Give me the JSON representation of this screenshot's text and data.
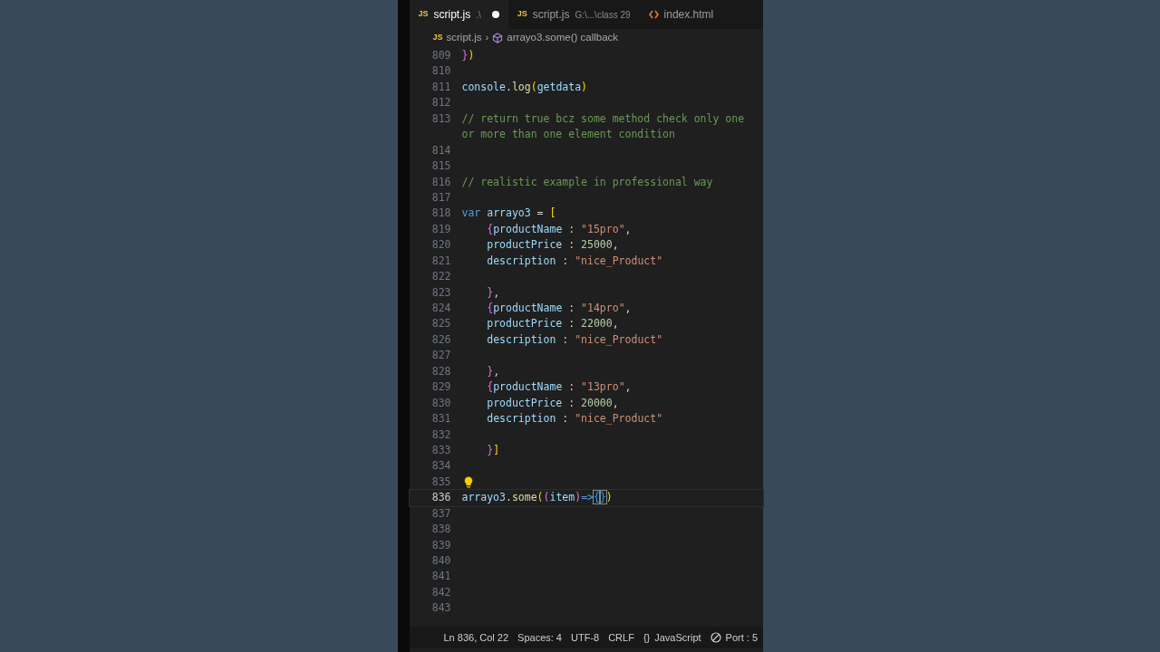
{
  "tabs": [
    {
      "kind": "js",
      "label": "script.js",
      "description": ".\\",
      "modified": true,
      "selected": true
    },
    {
      "kind": "js",
      "label": "script.js",
      "description": "G:\\...\\class 29",
      "modified": false,
      "selected": false
    },
    {
      "kind": "html",
      "label": "index.html",
      "modified": false,
      "selected": false
    }
  ],
  "breadcrumb": {
    "file_badge": "JS",
    "file": "script.js",
    "separator": "›",
    "symbol": "arrayo3.some() callback"
  },
  "tab_badges": [
    "JS",
    "JS"
  ],
  "lines": [
    {
      "no": "809",
      "current": false,
      "tokens": [
        {
          "kind": "b2",
          "text": "}"
        },
        {
          "kind": "b1",
          "text": ")"
        }
      ]
    },
    {
      "no": "810",
      "current": false
    },
    {
      "no": "811",
      "current": false,
      "tokens": [
        {
          "kind": "var",
          "text": "console"
        },
        {
          "kind": "punct",
          "text": "."
        },
        {
          "kind": "func",
          "text": "log"
        },
        {
          "kind": "b1",
          "text": "("
        },
        {
          "kind": "var",
          "text": "getdata"
        },
        {
          "kind": "b1",
          "text": ")"
        }
      ]
    },
    {
      "no": "812",
      "current": false
    },
    {
      "no": "813",
      "current": false,
      "tokens": [
        {
          "kind": "comment",
          "text": "// return true bcz some method check only one or more than one element condition"
        }
      ]
    },
    {
      "no": "814",
      "current": false
    },
    {
      "no": "815",
      "current": false
    },
    {
      "no": "816",
      "current": false,
      "tokens": [
        {
          "kind": "comment",
          "text": "// realistic example in professional way"
        }
      ]
    },
    {
      "no": "817",
      "current": false
    },
    {
      "no": "818",
      "current": false,
      "tokens": [
        {
          "kind": "keyword",
          "text": "var"
        },
        {
          "kind": "var",
          "text": " arrayo3"
        },
        {
          "kind": "punct",
          "text": " = "
        },
        {
          "kind": "b1",
          "text": "["
        }
      ]
    },
    {
      "no": "819",
      "current": false,
      "tokens": [
        {
          "kind": "b2",
          "text": "    {"
        },
        {
          "kind": "var",
          "text": "productName"
        },
        {
          "kind": "punct",
          "text": " : "
        },
        {
          "kind": "string",
          "text": "\"15pro\""
        },
        {
          "kind": "punct",
          "text": ","
        }
      ]
    },
    {
      "no": "820",
      "current": false,
      "tokens": [
        {
          "kind": "var",
          "text": "    productPrice"
        },
        {
          "kind": "punct",
          "text": " : "
        },
        {
          "kind": "number",
          "text": "25000"
        },
        {
          "kind": "punct",
          "text": ","
        }
      ]
    },
    {
      "no": "821",
      "current": false,
      "tokens": [
        {
          "kind": "var",
          "text": "    description"
        },
        {
          "kind": "punct",
          "text": " : "
        },
        {
          "kind": "string",
          "text": "\"nice_Product\""
        }
      ]
    },
    {
      "no": "822",
      "current": false
    },
    {
      "no": "823",
      "current": false,
      "tokens": [
        {
          "kind": "b2",
          "text": "    }"
        },
        {
          "kind": "punct",
          "text": ","
        }
      ]
    },
    {
      "no": "824",
      "current": false,
      "tokens": [
        {
          "kind": "b2",
          "text": "    {"
        },
        {
          "kind": "var",
          "text": "productName"
        },
        {
          "kind": "punct",
          "text": " : "
        },
        {
          "kind": "string",
          "text": "\"14pro\""
        },
        {
          "kind": "punct",
          "text": ","
        }
      ]
    },
    {
      "no": "825",
      "current": false,
      "tokens": [
        {
          "kind": "var",
          "text": "    productPrice"
        },
        {
          "kind": "punct",
          "text": " : "
        },
        {
          "kind": "number",
          "text": "22000"
        },
        {
          "kind": "punct",
          "text": ","
        }
      ]
    },
    {
      "no": "826",
      "current": false,
      "tokens": [
        {
          "kind": "var",
          "text": "    description"
        },
        {
          "kind": "punct",
          "text": " : "
        },
        {
          "kind": "string",
          "text": "\"nice_Product\""
        }
      ]
    },
    {
      "no": "827",
      "current": false
    },
    {
      "no": "828",
      "current": false,
      "tokens": [
        {
          "kind": "b2",
          "text": "    }"
        },
        {
          "kind": "punct",
          "text": ","
        }
      ]
    },
    {
      "no": "829",
      "current": false,
      "tokens": [
        {
          "kind": "b2",
          "text": "    {"
        },
        {
          "kind": "var",
          "text": "productName"
        },
        {
          "kind": "punct",
          "text": " : "
        },
        {
          "kind": "string",
          "text": "\"13pro\""
        },
        {
          "kind": "punct",
          "text": ","
        }
      ]
    },
    {
      "no": "830",
      "current": false,
      "tokens": [
        {
          "kind": "var",
          "text": "    productPrice"
        },
        {
          "kind": "punct",
          "text": " : "
        },
        {
          "kind": "number",
          "text": "20000"
        },
        {
          "kind": "punct",
          "text": ","
        }
      ]
    },
    {
      "no": "831",
      "current": false,
      "tokens": [
        {
          "kind": "var",
          "text": "    description"
        },
        {
          "kind": "punct",
          "text": " : "
        },
        {
          "kind": "string",
          "text": "\"nice_Product\""
        }
      ]
    },
    {
      "no": "832",
      "current": false
    },
    {
      "no": "833",
      "current": false,
      "tokens": [
        {
          "kind": "b2",
          "text": "    }"
        },
        {
          "kind": "b1",
          "text": "]"
        }
      ]
    },
    {
      "no": "834",
      "current": false
    },
    {
      "no": "835",
      "current": false,
      "lightbulb": true
    },
    {
      "no": "836",
      "current": true,
      "tokens": [
        {
          "kind": "var",
          "text": "arrayo3"
        },
        {
          "kind": "punct",
          "text": "."
        },
        {
          "kind": "func",
          "text": "some"
        },
        {
          "kind": "b1",
          "text": "("
        },
        {
          "kind": "b2",
          "text": "("
        },
        {
          "kind": "var",
          "text": "item"
        },
        {
          "kind": "b2",
          "text": ")"
        },
        {
          "kind": "keyword",
          "text": "=>"
        },
        {
          "kind": "match",
          "text": "{"
        },
        {
          "kind": "match",
          "text": "}"
        },
        {
          "kind": "b1",
          "text": ")"
        }
      ]
    },
    {
      "no": "837",
      "current": false
    },
    {
      "no": "838",
      "current": false
    },
    {
      "no": "839",
      "current": false
    },
    {
      "no": "840",
      "current": false
    },
    {
      "no": "841",
      "current": false
    },
    {
      "no": "842",
      "current": false
    },
    {
      "no": "843",
      "current": false
    }
  ],
  "status_bar": [
    {
      "kind": "text",
      "text": "Ln 836, Col 22"
    },
    {
      "kind": "text",
      "text": "Spaces: 4"
    },
    {
      "kind": "text",
      "text": "UTF-8"
    },
    {
      "kind": "text",
      "text": "CRLF"
    },
    {
      "kind": "language",
      "glyph": "{}",
      "text": "JavaScript"
    },
    {
      "kind": "port",
      "text": "Port : 5"
    }
  ]
}
